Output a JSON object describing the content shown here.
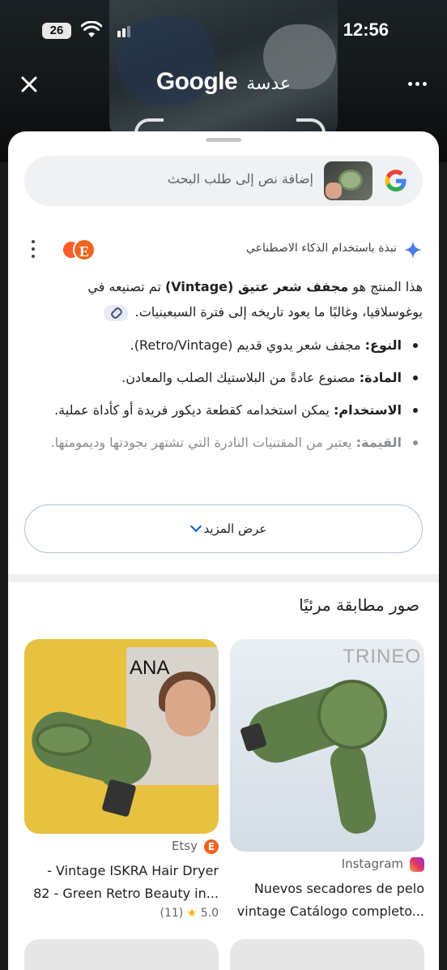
{
  "status_bar": {
    "battery": "26",
    "time": "12:56"
  },
  "app_bar": {
    "title_brand": "Google",
    "title_ar": "عدسة"
  },
  "search": {
    "placeholder": "إضافة نص إلى طلب البحث"
  },
  "ai_overview": {
    "label": "نبذة باستخدام الذكاء الاصطناعي",
    "intro_part1": "هذا المنتج هو ",
    "intro_bold": "مجفف شعر عتيق (Vintage)",
    "intro_part2": " تم تصنيعه في يوغوسلافيا، وغالبًا ما يعود تاريخه إلى فترة السبعينيات.",
    "bullets": [
      {
        "key": "النوع:",
        "value": " مجفف شعر يدوي قديم (Retro/Vintage)."
      },
      {
        "key": "المادة:",
        "value": " مصنوع عادةً من البلاستيك الصلب والمعادن."
      },
      {
        "key": "الاستخدام:",
        "value": " يمكن استخدامه كقطعة ديكور فريدة أو كأداة عملية."
      },
      {
        "key": "القيمة:",
        "value": " يعتبر من المقتنيات النادرة التي تشتهر بجودتها وديمومتها."
      }
    ],
    "show_more": "عرض المزيد"
  },
  "visual_matches": {
    "title": "صور مطابقة مرئيًا",
    "cards": [
      {
        "brand_text": "TRINEO",
        "source": "Instagram",
        "caption_line1": "Nuevos secadores de pelo",
        "caption_line2": "vintage Catálogo completo..."
      },
      {
        "box_text": "ANA",
        "source": "Etsy",
        "caption_line1": "- Vintage ISKRA Hair Dryer",
        "caption_line2": "82 - Green Retro Beauty in...",
        "rating": "5.0",
        "reviews": "(11)"
      }
    ]
  },
  "colors": {
    "accent": "#0b57d0",
    "etsy": "#f1641e",
    "dryer_green": "#5f7d49"
  }
}
